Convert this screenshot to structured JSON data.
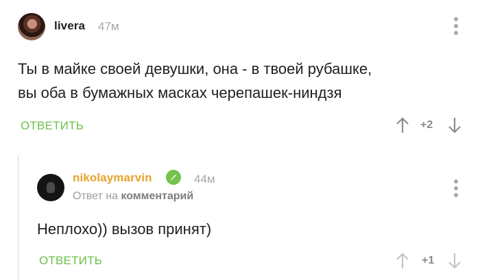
{
  "comments": [
    {
      "username": "livera",
      "time": "47м",
      "text_line1": "Ты в майке своей девушки, она - в твоей рубашке,",
      "text_line2": "вы оба в бумажных масках черепашек-ниндзя",
      "reply_label": "ОТВЕТИТЬ",
      "rating": "+2"
    },
    {
      "username": "nikolaymarvin",
      "time": "44м",
      "reply_to_prefix": "Ответ на",
      "reply_to_target": "комментарий",
      "text": "Неплохо)) вызов принят)",
      "reply_label": "ОТВЕТИТЬ",
      "rating": "+1"
    }
  ],
  "colors": {
    "accent_green": "#6bbf45",
    "username_orange": "#e8a32c",
    "muted": "#a7a7a7"
  },
  "icons": [
    "more-vertical-icon",
    "arrow-up-icon",
    "arrow-down-icon",
    "verified-check-icon"
  ]
}
